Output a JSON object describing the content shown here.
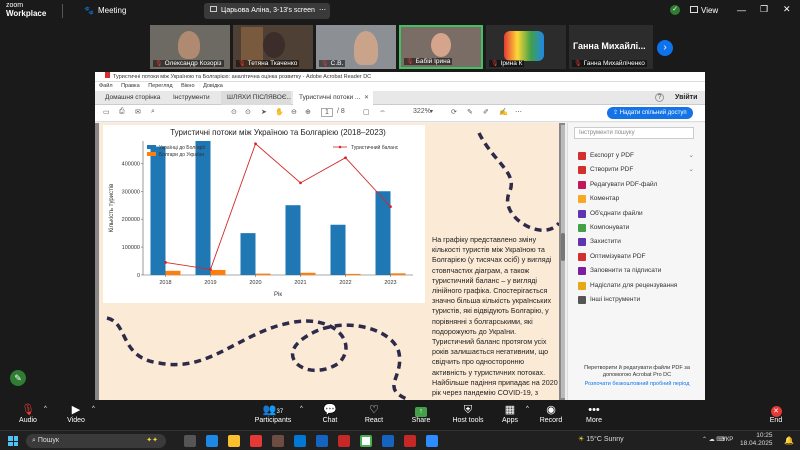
{
  "zoom": {
    "logo_line1": "zoom",
    "logo_line2": "Workplace",
    "meeting_label": "Meeting",
    "share_banner": "Царьова Аліна, 3-13's screen",
    "view_label": "View",
    "participants": [
      {
        "name": "Олександр Козоріз",
        "muted": true
      },
      {
        "name": "Тетяна Ткаченко",
        "muted": true
      },
      {
        "name": "С.В.",
        "muted": true
      },
      {
        "name": "Бабій Ірина",
        "muted": true
      },
      {
        "name": "Ірина К",
        "muted": true
      },
      {
        "name": "Ганна Михайліченко",
        "muted": true
      }
    ],
    "big_name": "Ганна  Михайлі...",
    "toolbar": {
      "audio": "Audio",
      "video": "Video",
      "participants": "Participants",
      "participants_count": "37",
      "chat": "Chat",
      "react": "React",
      "share": "Share",
      "host_tools": "Host tools",
      "apps": "Apps",
      "record": "Record",
      "more": "More",
      "end": "End"
    }
  },
  "reader": {
    "window_title": "Туристичні потоки між Україною та Болгарією: аналітична оцінка розвитку - Adobe Acrobat Reader DC",
    "menu": [
      "Файл",
      "Правка",
      "Перегляд",
      "Вікно",
      "Довідка"
    ],
    "tabs": [
      "Домашня сторінка",
      "Інструменти",
      "ШЛЯХИ ПІСЛЯВОЄ...",
      "Туристичні потоки ..."
    ],
    "sign_in": "Увійти",
    "page_current": "1",
    "page_total": "/ 8",
    "zoom_level": "322%",
    "share_button": "Надати спільний доступ",
    "search_placeholder": "Інструменти пошуку",
    "tools": [
      {
        "label": "Експорт у PDF",
        "color": "#d32f2f",
        "chev": true
      },
      {
        "label": "Створити PDF",
        "color": "#d32f2f",
        "chev": true
      },
      {
        "label": "Редагувати PDF-файл",
        "color": "#c2185b",
        "chev": false
      },
      {
        "label": "Коментар",
        "color": "#f9a825",
        "chev": false
      },
      {
        "label": "Об'єднати файли",
        "color": "#5e35b1",
        "chev": false
      },
      {
        "label": "Компонувати",
        "color": "#43a047",
        "chev": false
      },
      {
        "label": "Захистити",
        "color": "#5e35b1",
        "chev": false
      },
      {
        "label": "Оптимізувати PDF",
        "color": "#d32f2f",
        "chev": false
      },
      {
        "label": "Заповнити та підписати",
        "color": "#7b1fa2",
        "chev": false
      },
      {
        "label": "Надіслати для рецензування",
        "color": "#e6a817",
        "chev": false
      },
      {
        "label": "Інші інструменти",
        "color": "#555555",
        "chev": false
      }
    ],
    "promo_text": "Перетворити й редагувати файли PDF за допомогою Acrobat Pro DC",
    "promo_link": "Розпочати безкоштовний пробний період",
    "page_text": "На графіку представлено зміну кількості туристів між Україною та Болгарією (у тисячах осіб) у вигляді стовпчастих діаграм, а також туристичний баланс – у вигляді лінійного графіка. Спостерігається значно більша кількість українських туристів, які відвідують Болгарію, у порівнянні з болгарськими, які подорожують до України. Туристичний баланс протягом усіх років залишається негативним, що свідчить про односторонню активність у туристичних потоках. Найбільше падіння припадає на 2020 рік через пандемію COVID-19, з подальшим поступовим відновленням до 2023 року."
  },
  "taskbar": {
    "search": "Пошук",
    "weather": "15°C  Sunny",
    "lang": "УКР",
    "time": "10:25",
    "date": "18.04.2025"
  },
  "chart_data": {
    "type": "bar",
    "title": "Туристичні потоки між Україною та Болгарією (2018–2023)",
    "categories": [
      "2018",
      "2019",
      "2020",
      "2021",
      "2022",
      "2023"
    ],
    "xlabel": "Рік",
    "ylabel": "Кількість туристів",
    "ylim": [
      0,
      480000
    ],
    "yticks": [
      0,
      100000,
      200000,
      300000,
      400000
    ],
    "series": [
      {
        "name": "Українці до Болгарії",
        "kind": "bar",
        "color": "#1f77b4",
        "values": [
          460000,
          480000,
          150000,
          250000,
          180000,
          300000
        ]
      },
      {
        "name": "Болгари до України",
        "kind": "bar",
        "color": "#ff7f0e",
        "values": [
          15000,
          18000,
          5000,
          8000,
          4000,
          6000
        ]
      },
      {
        "name": "Туристичний баланс",
        "kind": "line",
        "color": "#d62728",
        "values": [
          45000,
          20000,
          470000,
          330000,
          420000,
          245000
        ]
      }
    ],
    "legend_position": "top-left / top-right"
  }
}
